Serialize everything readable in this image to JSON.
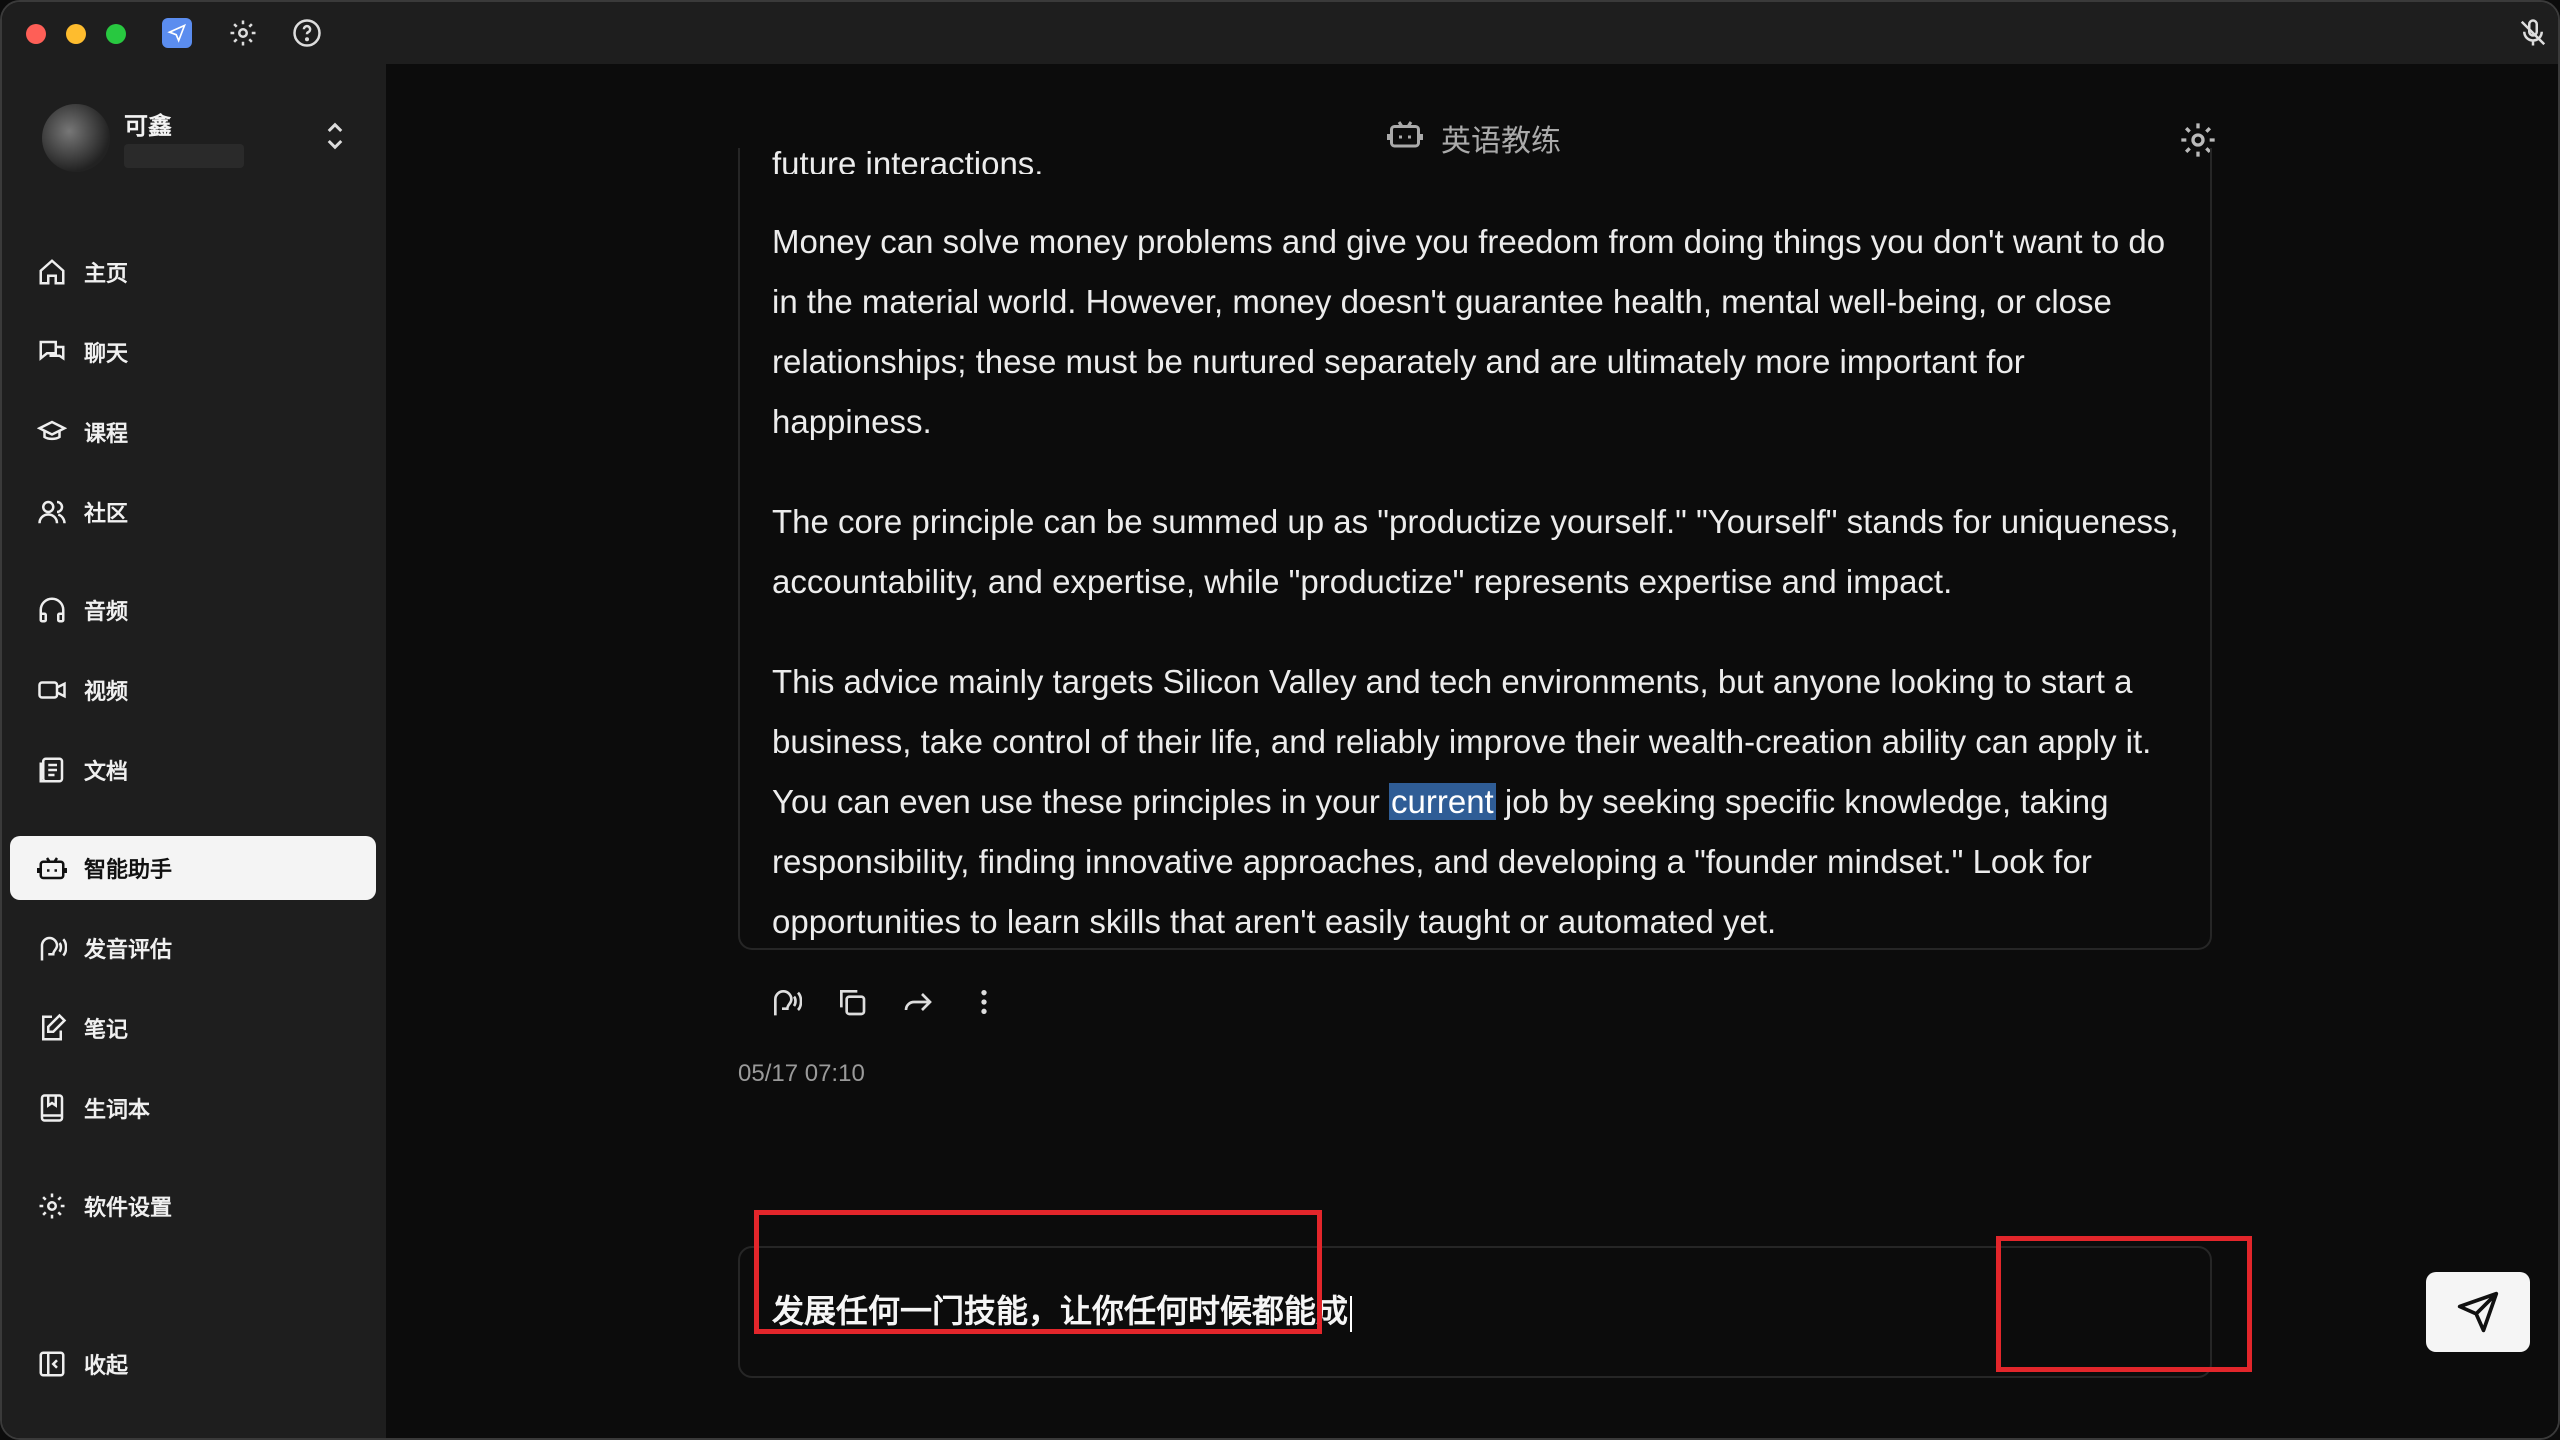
{
  "titlebar": {
    "icons": [
      "app-icon",
      "gear-icon",
      "help-icon",
      "mic-off-icon"
    ]
  },
  "profile": {
    "name": "可鑫"
  },
  "sidebar": {
    "items": [
      {
        "label": "主页",
        "icon": "home-icon"
      },
      {
        "label": "聊天",
        "icon": "chat-icon"
      },
      {
        "label": "课程",
        "icon": "graduation-cap-icon"
      },
      {
        "label": "社区",
        "icon": "users-icon"
      },
      {
        "label": "音频",
        "icon": "headphones-icon"
      },
      {
        "label": "视频",
        "icon": "video-icon"
      },
      {
        "label": "文档",
        "icon": "document-icon"
      },
      {
        "label": "智能助手",
        "icon": "robot-icon",
        "active": true
      },
      {
        "label": "发音评估",
        "icon": "speech-icon"
      },
      {
        "label": "笔记",
        "icon": "note-icon"
      },
      {
        "label": "生词本",
        "icon": "bookmark-icon"
      },
      {
        "label": "软件设置",
        "icon": "gear-icon"
      }
    ],
    "collapse_label": "收起"
  },
  "header": {
    "title": "英语教练"
  },
  "message": {
    "cut_line": "future interactions.",
    "p1": "Money can solve money problems and give you freedom from doing things you don't want to do in the material world. However, money doesn't guarantee health, mental well-being, or close relationships; these must be nurtured separately and are ultimately more important for happiness.",
    "p2": "The core principle can be summed up as \"productize yourself.\" \"Yourself\" stands for uniqueness, accountability, and expertise, while \"productize\" represents expertise and impact.",
    "p3_before": "This advice mainly targets Silicon Valley and tech environments, but anyone looking to start a business, take control of their life, and reliably improve their wealth-creation ability can apply it. You can even use these principles in your ",
    "p3_highlight": "current",
    "p3_after": " job by seeking specific knowledge, taking responsibility, finding innovative approaches, and developing a \"founder mindset.\" Look for opportunities to learn skills that aren't easily taught or automated yet.",
    "timestamp": "05/17 07:10"
  },
  "composer": {
    "value": "发展任何一门技能，让你任何时候都能成"
  },
  "colors": {
    "highlight_box": "#e3262b",
    "active_nav": "#f4f4f4"
  }
}
